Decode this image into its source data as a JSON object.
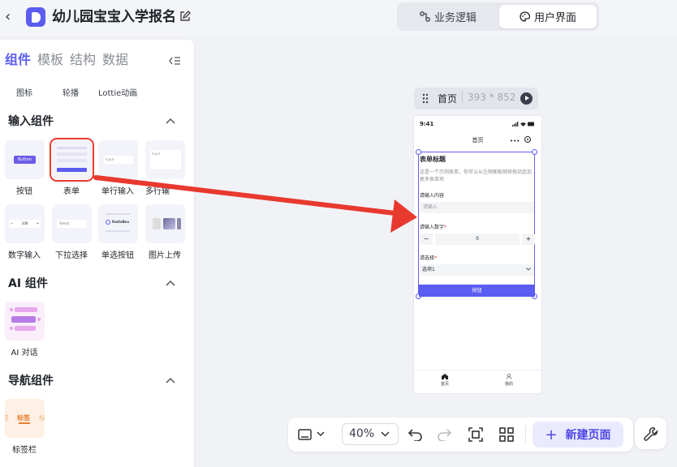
{
  "app": {
    "title": "幼儿园宝宝入学报名"
  },
  "modes": {
    "logic": "业务逻辑",
    "ui": "用户界面"
  },
  "panel": {
    "tabs": [
      "组件",
      "模板",
      "结构",
      "数据"
    ],
    "top_row": [
      "图标",
      "轮播",
      "Lottie动画"
    ],
    "sections": {
      "input": "输入组件",
      "ai": "AI 组件",
      "nav": "导航组件"
    },
    "input_items": [
      "按钮",
      "表单",
      "单行输入",
      "多行输",
      "数字输入",
      "下拉选择",
      "单选按钮",
      "图片上传"
    ],
    "thumb_text": {
      "button": "Button",
      "input": "Input",
      "input2": "Input",
      "num": "100",
      "select": "Select",
      "radio": "RadioBox"
    },
    "ai_items": [
      "AI 对话"
    ],
    "nav_items": [
      "标签栏"
    ],
    "nav_thumb": {
      "left": "签",
      "mid": "标签",
      "right": "标"
    }
  },
  "canvas": {
    "page_name": "首页",
    "page_size": "393 * 852"
  },
  "phone": {
    "time": "9:41",
    "nav_title": "首页",
    "nav_more": "•••",
    "form": {
      "title": "表单标题",
      "desc": "这是一个示例表单，你可以从左侧面板继续拖动追加更多表单项",
      "label_text": "请输入内容",
      "placeholder": "请输入",
      "label_number": "请输入数字",
      "required_mark": "*",
      "stepper_minus": "−",
      "stepper_value": "0",
      "stepper_plus": "+",
      "label_select": "请选择",
      "select_value": "选项1",
      "button": "按钮"
    },
    "tabbar": [
      "首页",
      "我的"
    ]
  },
  "toolbar": {
    "zoom": "40%",
    "new_page": "新建页面",
    "new_page_plus": "+"
  },
  "colors": {
    "accent": "#5b5cf0",
    "highlight": "#e8392f"
  }
}
